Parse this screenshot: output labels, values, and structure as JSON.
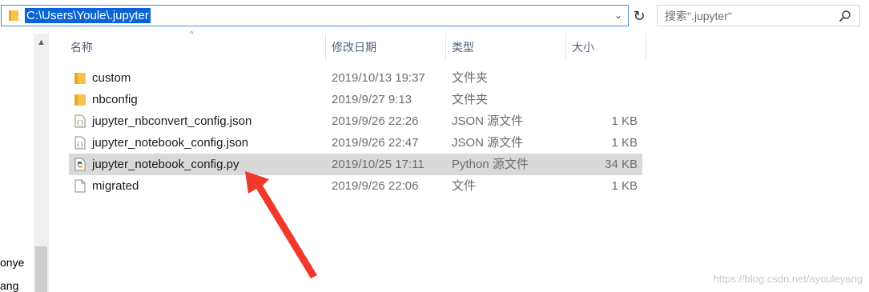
{
  "address_bar": {
    "path": "C:\\Users\\Youle\\.jupyter"
  },
  "search": {
    "placeholder": "搜索\".jupyter\""
  },
  "nav_pane": {
    "fragment_1": "onye",
    "fragment_2": "ang"
  },
  "columns": {
    "name": "名称",
    "date": "修改日期",
    "type": "类型",
    "size": "大小"
  },
  "files": [
    {
      "name": "custom",
      "date": "2019/10/13 19:37",
      "type": "文件夹",
      "size": "",
      "icon": "folder-icon"
    },
    {
      "name": "nbconfig",
      "date": "2019/9/27 9:13",
      "type": "文件夹",
      "size": "",
      "icon": "folder-icon"
    },
    {
      "name": "jupyter_nbconvert_config.json",
      "date": "2019/9/26 22:26",
      "type": "JSON 源文件",
      "size": "1 KB",
      "icon": "json-file-icon"
    },
    {
      "name": "jupyter_notebook_config.json",
      "date": "2019/9/26 22:47",
      "type": "JSON 源文件",
      "size": "1 KB",
      "icon": "json-file-icon"
    },
    {
      "name": "jupyter_notebook_config.py",
      "date": "2019/10/25 17:11",
      "type": "Python 源文件",
      "size": "34 KB",
      "icon": "python-file-icon",
      "selected": true
    },
    {
      "name": "migrated",
      "date": "2019/9/26 22:06",
      "type": "文件",
      "size": "1 KB",
      "icon": "blank-file-icon"
    }
  ],
  "watermark": "https://blog.csdn.net/ayouleyang",
  "colors": {
    "selection": "#d9d9d9",
    "address_highlight": "#0a64d6",
    "annotation_arrow": "#f0392b",
    "folder": "#f6c34a"
  }
}
